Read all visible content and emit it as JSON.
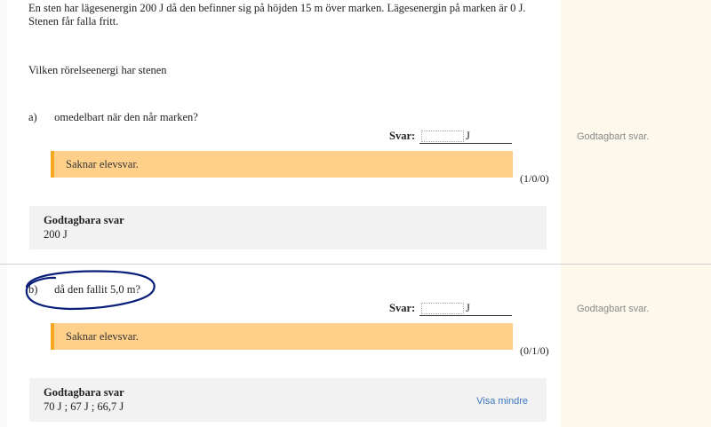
{
  "intro": {
    "text": "En sten har lägesenergin 200 J då den befinner sig på höjden 15 m över marken. Lägesenergin på marken är 0 J. Stenen får falla fritt."
  },
  "question": "Vilken rörelseenergi har stenen",
  "parts": [
    {
      "letter": "a)",
      "text": "omedelbart när den når marken?",
      "svar_label": "Svar:",
      "answer_value": "",
      "unit": "J",
      "alert": "Saknar elevsvar.",
      "points": "(1/0/0)",
      "grade": "Godtagbart svar.",
      "accepted_title": "Godtagbara svar",
      "accepted_value": "200 J"
    },
    {
      "letter": "b)",
      "text": "då den fallit 5,0 m?",
      "svar_label": "Svar:",
      "answer_value": "",
      "unit": "J",
      "alert": "Saknar elevsvar.",
      "points": "(0/1/0)",
      "grade": "Godtagbart svar.",
      "accepted_title": "Godtagbara svar",
      "accepted_value": "70 J ; 67 J ; 66,7 J",
      "toggle_label": "Visa mindre"
    }
  ],
  "colors": {
    "alert_bg": "#ffd08a",
    "alert_border": "#f5a623",
    "side_panel": "#fcf9ec",
    "link": "#3b78c2",
    "scribble": "#0a1f7a"
  }
}
